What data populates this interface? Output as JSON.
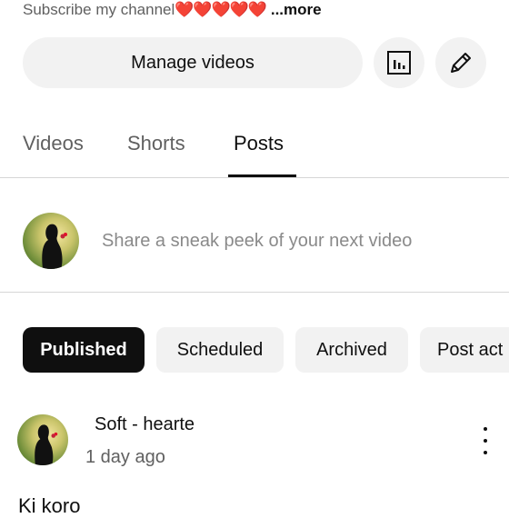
{
  "channel": {
    "description_text": "Subscribe my channel",
    "description_hearts": "❤️❤️❤️❤️❤️",
    "more_label": "...more"
  },
  "actions": {
    "manage_videos_label": "Manage videos",
    "analytics_icon": "analytics-icon",
    "edit_icon": "pencil-icon"
  },
  "tabs": [
    {
      "label": "Videos",
      "active": false
    },
    {
      "label": "Shorts",
      "active": false
    },
    {
      "label": "Posts",
      "active": true
    }
  ],
  "composer": {
    "placeholder": "Share a sneak peek of your next video"
  },
  "filters": [
    {
      "label": "Published",
      "active": true
    },
    {
      "label": "Scheduled",
      "active": false
    },
    {
      "label": "Archived",
      "active": false
    },
    {
      "label": "Post act",
      "active": false
    }
  ],
  "post": {
    "author": "Soft - hearte",
    "time": "1 day ago",
    "body": "Ki koro"
  },
  "colors": {
    "accent_dark": "#0f0f0f",
    "chip_bg": "#f2f2f2",
    "heart": "#e0112b"
  }
}
